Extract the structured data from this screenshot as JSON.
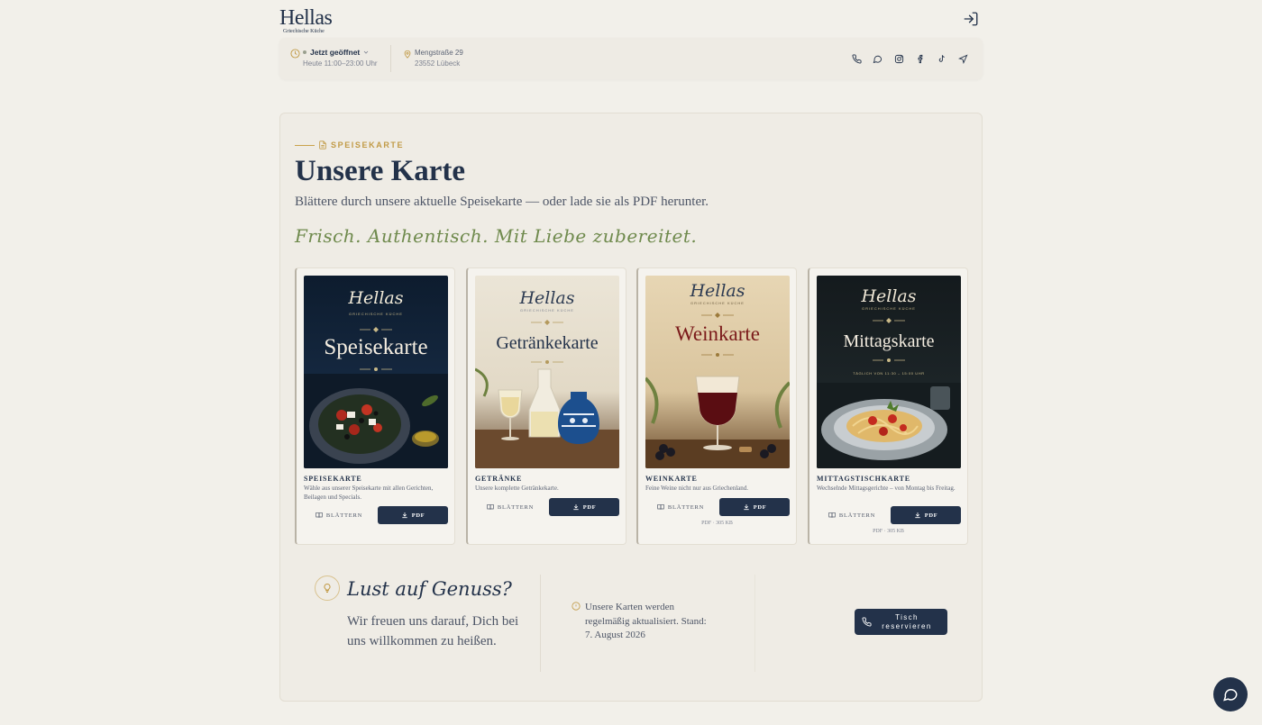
{
  "header": {
    "logo_main": "Hellas",
    "logo_sub": "Griechische Küche"
  },
  "infobar": {
    "status": "Jetzt geöffnet",
    "hours": "Heute 11:00–23:00 Uhr",
    "street": "Mengstraße 29",
    "city": "23552 Lübeck",
    "icons": [
      "phone-icon",
      "whatsapp-icon",
      "instagram-icon",
      "facebook-icon",
      "tiktok-icon",
      "navigation-icon"
    ]
  },
  "section": {
    "eyebrow": "SPEISEKARTE",
    "title": "Unsere Karte",
    "lead": "Blättere durch unsere aktuelle Speisekarte — oder lade sie als PDF herunter.",
    "script": "Frisch. Authentisch. Mit Liebe zubereitet."
  },
  "cards": [
    {
      "cover_logo": "Hellas",
      "cover_sub": "GRIECHISCHE KÜCHE",
      "cover_title": "Speisekarte",
      "title": "SPEISEKARTE",
      "desc": "Wähle aus unserer Speisekarte mit allen Gerichten, Beilagen und Specials.",
      "browse": "BLÄTTERN",
      "pdf": "PDF"
    },
    {
      "cover_logo": "Hellas",
      "cover_sub": "GRIECHISCHE KÜCHE",
      "cover_title": "Getränkekarte",
      "title": "GETRÄNKE",
      "desc": "Unsere komplette Getränkekarte.",
      "browse": "BLÄTTERN",
      "pdf": "PDF"
    },
    {
      "cover_logo": "Hellas",
      "cover_sub": "GRIECHISCHE KÜCHE",
      "cover_title": "Weinkarte",
      "title": "WEINKARTE",
      "desc": "Feine Weine nicht nur aus Griechenland.",
      "browse": "BLÄTTERN",
      "pdf": "PDF",
      "size": "PDF · 305 KB"
    },
    {
      "cover_logo": "Hellas",
      "cover_sub": "GRIECHISCHE KÜCHE",
      "cover_title": "Mittagskarte",
      "cover_hours": "TÄGLICH VON 11:30 – 15:00 UHR",
      "title": "MITTAGSTISCHKARTE",
      "desc": "Wechselnde Mittagsgerichte – von Montag bis Freitag.",
      "browse": "BLÄTTERN",
      "pdf": "PDF",
      "size": "PDF · 305 KB"
    }
  ],
  "cta": {
    "script": "Lust auf Genuss?",
    "text": "Wir freuen uns darauf, Dich bei uns willkommen zu heißen.",
    "update_text": "Unsere Karten werden regelmäßig aktualisiert. Stand: 7. August 2026",
    "reserve": "Tisch reservieren"
  },
  "colors": {
    "navy": "#23324a",
    "gold": "#c19a45",
    "olive": "#6f8a4d",
    "background": "#f2f0ea"
  }
}
